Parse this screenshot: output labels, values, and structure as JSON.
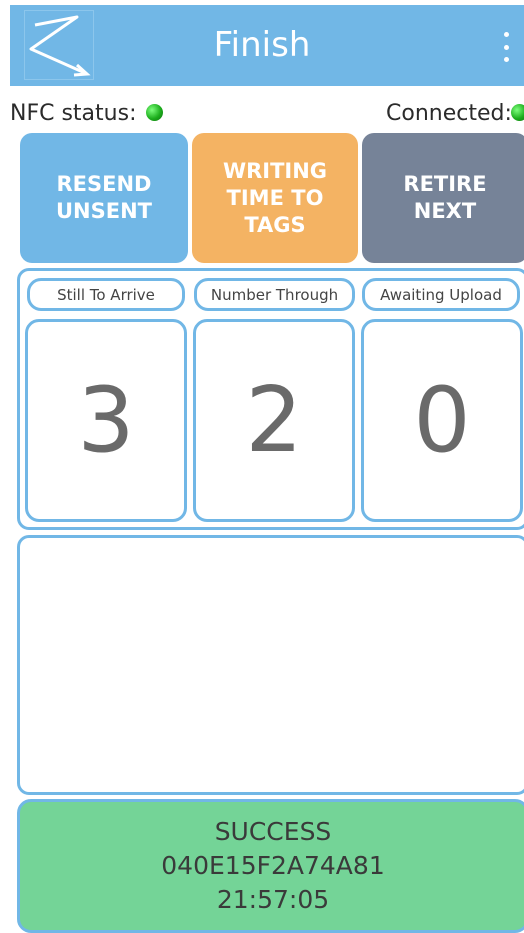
{
  "app_bar": {
    "title": "Finish",
    "logo_icon": "route-arrow-icon",
    "menu_icon": "more-vert-icon",
    "color": "#71b7e6"
  },
  "status": {
    "nfc_label": "NFC status:",
    "nfc_state": "on",
    "connected_label": "Connected:",
    "connected_state": "on",
    "indicator_color": "#1dae1d"
  },
  "actions": [
    {
      "label": "RESEND\nUNSENT",
      "color": "#71b7e6"
    },
    {
      "label": "WRITING\nTIME TO\nTAGS",
      "color": "#f4b363"
    },
    {
      "label": "RETIRE\nNEXT",
      "color": "#768398"
    }
  ],
  "stats": [
    {
      "label": "Still To Arrive",
      "value": "3"
    },
    {
      "label": "Number Through",
      "value": "2"
    },
    {
      "label": "Awaiting Upload",
      "value": "0"
    }
  ],
  "result": {
    "status": "SUCCESS",
    "tag_id": "040E15F2A74A81",
    "time": "21:57:05",
    "color": "#74d497"
  }
}
